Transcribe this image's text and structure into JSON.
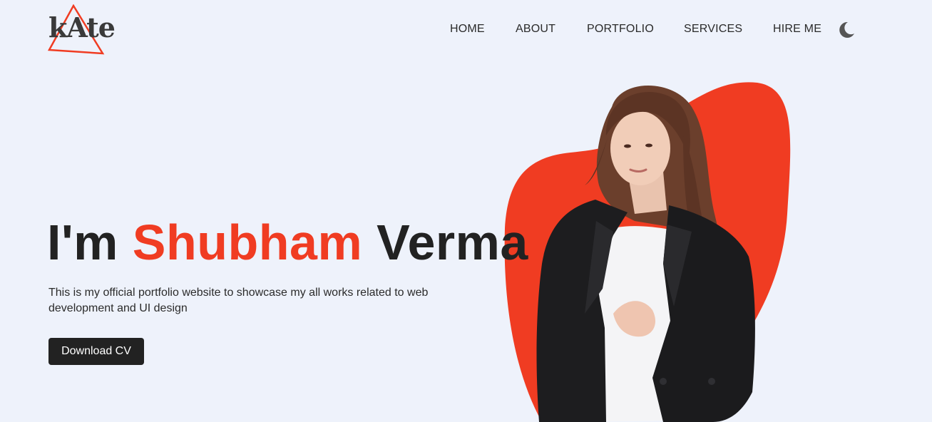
{
  "logo": {
    "text": "kAte"
  },
  "nav": {
    "items": [
      {
        "label": "HOME"
      },
      {
        "label": "ABOUT"
      },
      {
        "label": "PORTFOLIO"
      },
      {
        "label": "SERVICES"
      },
      {
        "label": "HIRE ME"
      }
    ],
    "theme_toggle_icon": "moon-icon"
  },
  "hero": {
    "greeting": "I'm",
    "first_name": "Shubham",
    "last_name": "Verma",
    "description": "This is my official portfolio website to showcase my all works related to web development and UI design",
    "cta_label": "Download CV"
  },
  "colors": {
    "accent": "#f03c22",
    "background": "#eef2fb",
    "text": "#222222"
  }
}
